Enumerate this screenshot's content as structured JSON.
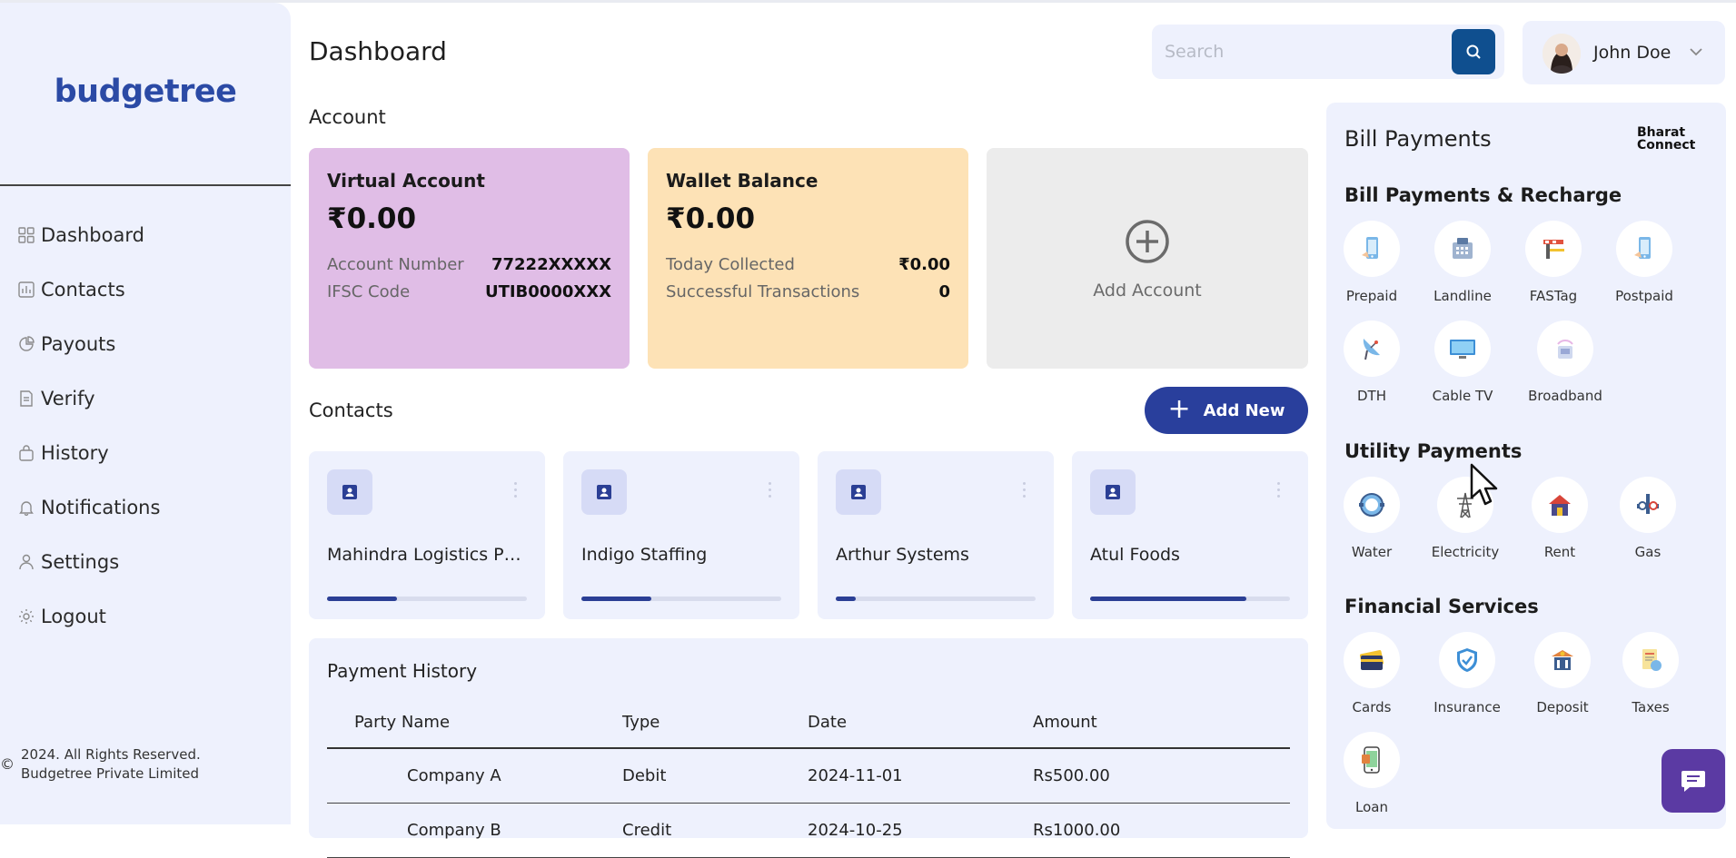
{
  "brand": {
    "logo_text": "budgetree"
  },
  "sidebar": {
    "items": [
      {
        "label": "Dashboard",
        "icon": "dashboard-icon"
      },
      {
        "label": "Contacts",
        "icon": "contacts-icon"
      },
      {
        "label": "Payouts",
        "icon": "payouts-icon"
      },
      {
        "label": "Verify",
        "icon": "verify-icon"
      },
      {
        "label": "History",
        "icon": "history-icon"
      },
      {
        "label": "Notifications",
        "icon": "bell-icon"
      },
      {
        "label": "Settings",
        "icon": "settings-icon"
      },
      {
        "label": "Logout",
        "icon": "logout-icon"
      }
    ],
    "copyright_symbol": "©",
    "copyright_line1": "2024. All Rights Reserved.",
    "copyright_line2": "Budgetree Private Limited"
  },
  "header": {
    "title": "Dashboard",
    "search_placeholder": "Search",
    "user_name": "John Doe"
  },
  "account": {
    "section_label": "Account",
    "virtual": {
      "title": "Virtual Account",
      "amount": "₹0.00",
      "rows": [
        {
          "label": "Account Number",
          "value": "77222XXXXX"
        },
        {
          "label": "IFSC Code",
          "value": "UTIB0000XXX"
        }
      ]
    },
    "wallet": {
      "title": "Wallet Balance",
      "amount": "₹0.00",
      "rows": [
        {
          "label": "Today Collected",
          "value": "₹0.00"
        },
        {
          "label": "Successful Transactions",
          "value": "0"
        }
      ]
    },
    "add_account_label": "Add Account"
  },
  "contacts": {
    "section_label": "Contacts",
    "add_new_label": "Add New",
    "items": [
      {
        "name": "Mahindra Logistics Pvt ...",
        "progress": 0.35
      },
      {
        "name": "Indigo Staffing",
        "progress": 0.35
      },
      {
        "name": "Arthur Systems",
        "progress": 0.1
      },
      {
        "name": "Atul Foods",
        "progress": 0.78
      }
    ]
  },
  "payment_history": {
    "title": "Payment History",
    "columns": [
      "Party Name",
      "Type",
      "Date",
      "Amount"
    ],
    "rows": [
      [
        "Company A",
        "Debit",
        "2024-11-01",
        "Rs500.00"
      ],
      [
        "Company B",
        "Credit",
        "2024-10-25",
        "Rs1000.00"
      ]
    ]
  },
  "bill_panel": {
    "title": "Bill Payments",
    "partner_line1": "Bharat",
    "partner_line2": "Connect",
    "sections": [
      {
        "title": "Bill Payments & Recharge",
        "items": [
          "Prepaid",
          "Landline",
          "FASTag",
          "Postpaid",
          "DTH",
          "Cable TV",
          "Broadband"
        ]
      },
      {
        "title": "Utility Payments",
        "items": [
          "Water",
          "Electricity",
          "Rent",
          "Gas"
        ]
      },
      {
        "title": "Financial Services",
        "items": [
          "Cards",
          "Insurance",
          "Deposit",
          "Taxes",
          "Loan"
        ]
      }
    ]
  },
  "colors": {
    "sidebar_bg": "#eef1fd",
    "primary": "#293f9c",
    "virtual_card": "#e0bde6",
    "wallet_card": "#fde2b6",
    "chat_button": "#5b3aa3"
  }
}
